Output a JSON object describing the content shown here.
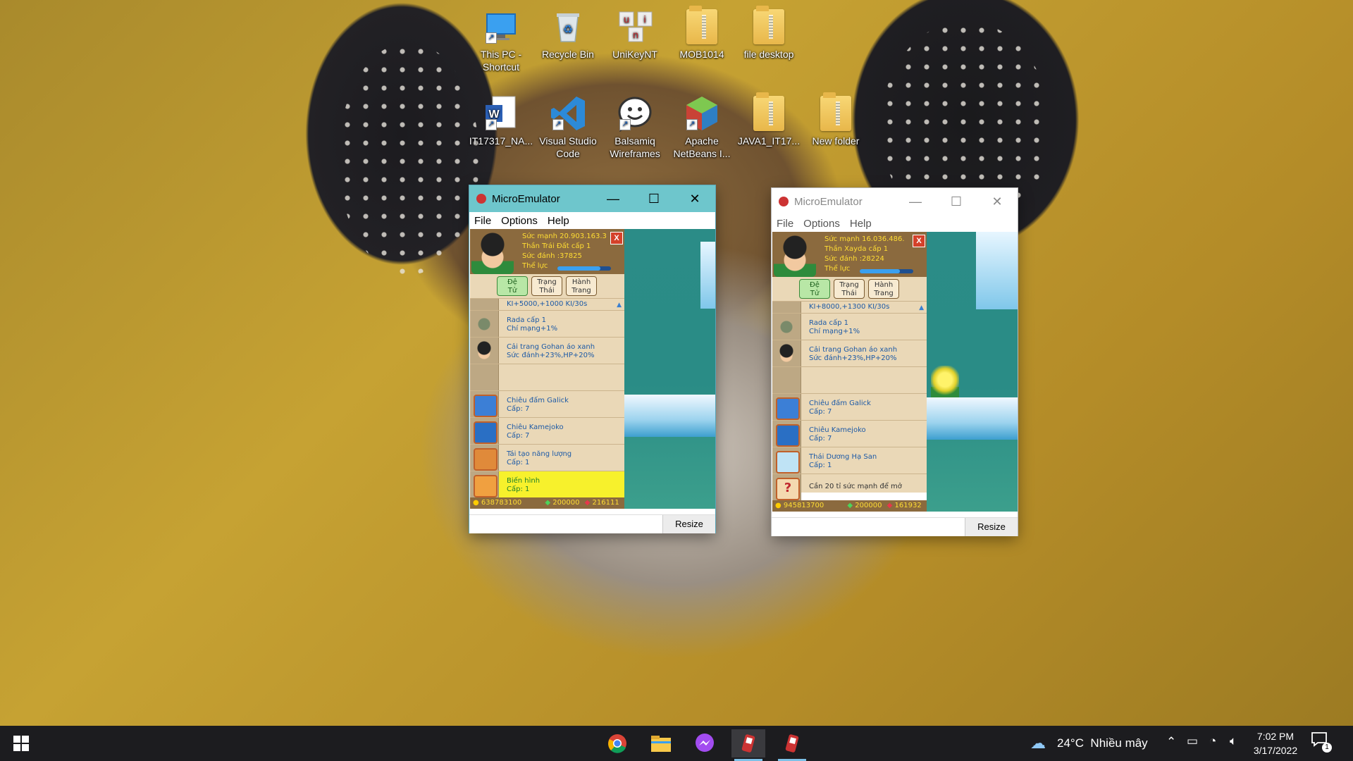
{
  "desktop": {
    "icons": [
      {
        "label": "This PC - Shortcut",
        "icon": "pc-icon"
      },
      {
        "label": "Recycle Bin",
        "icon": "recycle-bin-icon"
      },
      {
        "label": "UniKeyNT",
        "icon": "unikey-icon"
      },
      {
        "label": "MOB1014",
        "icon": "folder-icon"
      },
      {
        "label": "file desktop",
        "icon": "folder-icon"
      },
      {
        "label": "IT17317_NA...",
        "icon": "word-icon"
      },
      {
        "label": "Visual Studio Code",
        "icon": "vscode-icon"
      },
      {
        "label": "Balsamiq Wireframes",
        "icon": "balsamiq-icon"
      },
      {
        "label": "Apache NetBeans I...",
        "icon": "netbeans-icon"
      },
      {
        "label": "JAVA1_IT17...",
        "icon": "folder-icon"
      },
      {
        "label": "New folder",
        "icon": "folder-icon"
      }
    ]
  },
  "emu1": {
    "title": "MicroEmulator",
    "menu": [
      "File",
      "Options",
      "Help"
    ],
    "header": [
      "Sức mạnh 20.903.163.3",
      "Thần Trái Đất cấp 1",
      "Sức đánh :37825",
      "Thể lực"
    ],
    "stamina": 0.8,
    "tabs": [
      [
        "Đệ",
        "Tử"
      ],
      [
        "Trạng",
        "Thái"
      ],
      [
        "Hành",
        "Trang"
      ]
    ],
    "rows": [
      [
        "KI+5000,+1000 KI/30s",
        ""
      ],
      [
        "Rada cấp 1",
        "Chí mạng+1%"
      ],
      [
        "Cải trang Gohan áo xanh",
        "Sức đánh+23%,HP+20%"
      ],
      [
        "",
        ""
      ],
      [
        "Chiêu đấm Galick",
        "Cấp: 7"
      ],
      [
        "Chiêu Kamejoko",
        "Cấp: 7"
      ],
      [
        "Tái tạo năng lượng",
        "Cấp: 1"
      ],
      [
        "Biến hình",
        "Cấp: 1"
      ]
    ],
    "footer": {
      "gold": "638783100",
      "gem": "200000",
      "ruby": "216111"
    },
    "resize": "Resize"
  },
  "emu2": {
    "title": "MicroEmulator",
    "menu": [
      "File",
      "Options",
      "Help"
    ],
    "header": [
      "Sức mạnh 16.036.486.",
      "Thần Xayda cấp 1",
      "Sức đánh :28224",
      "Thể lực"
    ],
    "stamina": 0.75,
    "tabs": [
      [
        "Đệ",
        "Tử"
      ],
      [
        "Trạng",
        "Thái"
      ],
      [
        "Hành",
        "Trang"
      ]
    ],
    "rows": [
      [
        "KI+8000,+1300 KI/30s",
        ""
      ],
      [
        "Rada cấp 1",
        "Chí mạng+1%"
      ],
      [
        "Cải trang Gohan áo xanh",
        "Sức đánh+23%,HP+20%"
      ],
      [
        "",
        ""
      ],
      [
        "Chiêu đấm Galick",
        "Cấp: 7"
      ],
      [
        "Chiêu Kamejoko",
        "Cấp: 7"
      ],
      [
        "Thái Dương Hạ San",
        "Cấp: 1"
      ],
      [
        "Cần 20 tỉ sức mạnh để mở",
        ""
      ]
    ],
    "footer": {
      "gold": "945813700",
      "gem": "200000",
      "ruby": "161932"
    },
    "resize": "Resize"
  },
  "taskbar": {
    "weather": "24°C  Nhiều mây",
    "time": "7:02 PM",
    "date": "3/17/2022",
    "notifications": "1"
  }
}
